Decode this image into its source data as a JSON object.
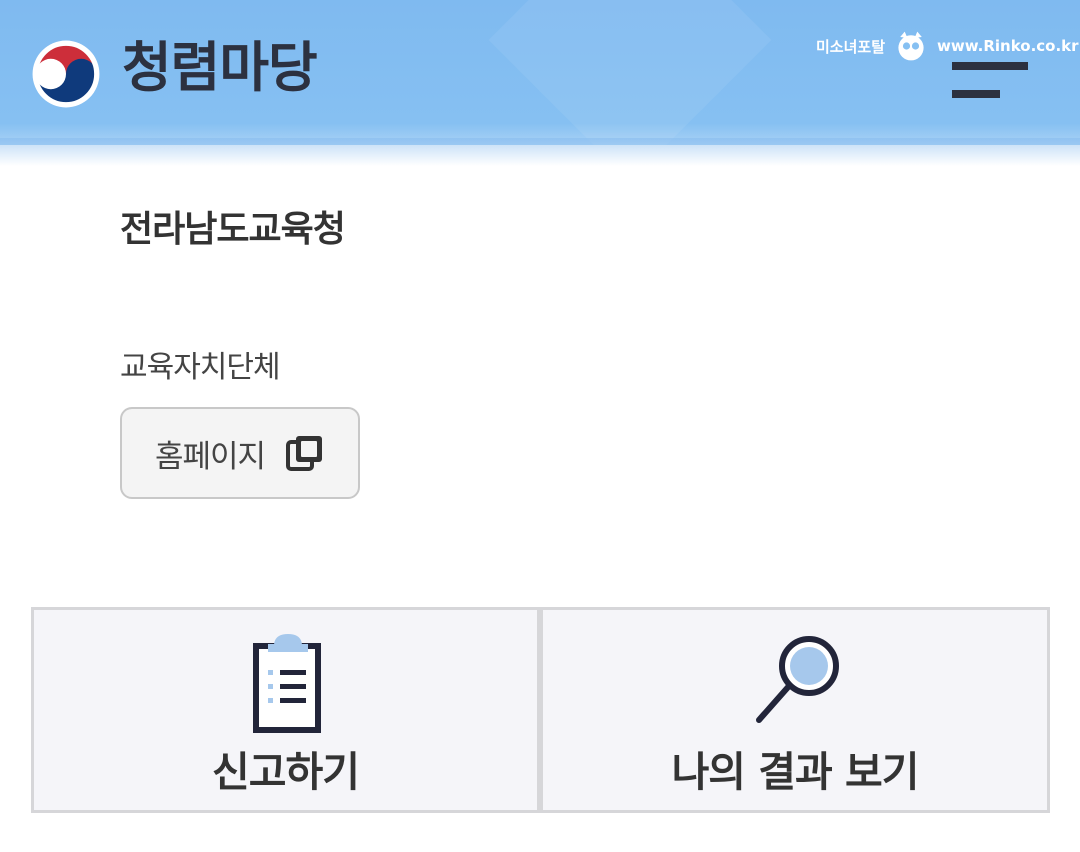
{
  "header": {
    "app_title": "청렴마당",
    "watermark_text": "미소녀포탈",
    "watermark_url": "www.Rinko.co.kr",
    "menu_icon": "hamburger-menu-icon",
    "logo_icon": "taegeuk-emblem-icon"
  },
  "main": {
    "organization": "전라남도교육청",
    "category": "교육자치단체",
    "homepage_button": {
      "label": "홈페이지",
      "icon": "copy-icon"
    }
  },
  "actions": [
    {
      "label": "신고하기",
      "icon": "clipboard-list-icon"
    },
    {
      "label": "나의 결과 보기",
      "icon": "magnifier-icon"
    }
  ],
  "colors": {
    "header_bg": "#86c0f2",
    "text_dark": "#2c3140",
    "emblem_red": "#cd2e3a",
    "emblem_blue": "#0f3a7c",
    "card_bg": "#f5f5f9",
    "icon_accent": "#a6c8ec"
  }
}
